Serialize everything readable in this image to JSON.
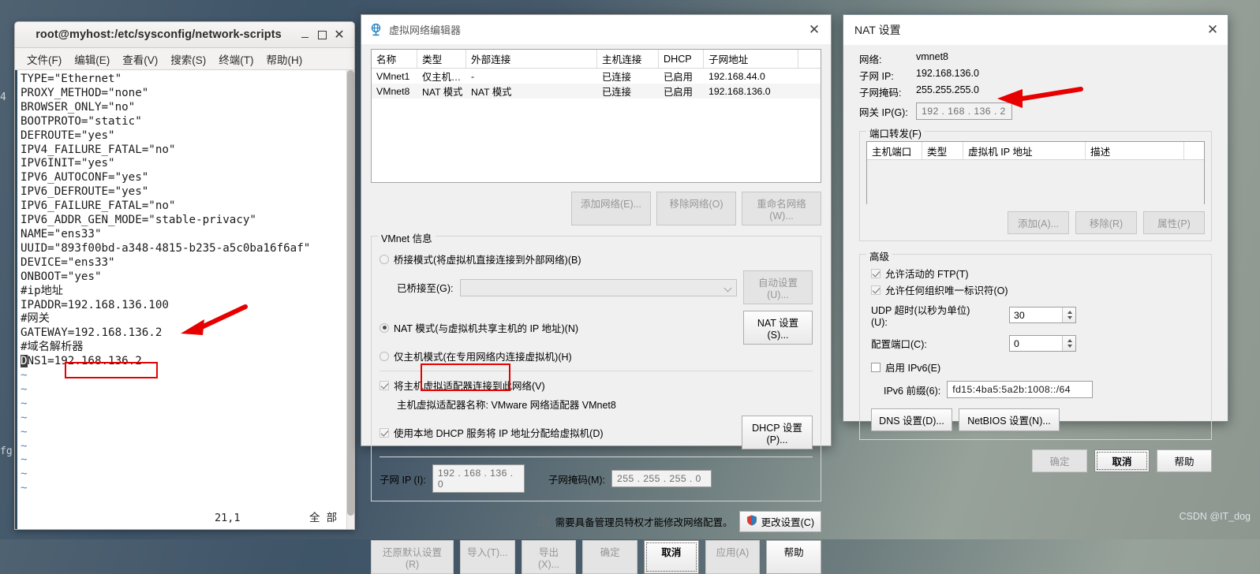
{
  "desktop": {
    "stray_text_left": "4",
    "stray_text_bottom": "fg",
    "watermark": "CSDN @IT_dog"
  },
  "terminal": {
    "title": "root@myhost:/etc/sysconfig/network-scripts",
    "buttons": {
      "minimize": "–",
      "maximize": "□",
      "close": "✕"
    },
    "menu": [
      "文件(F)",
      "编辑(E)",
      "查看(V)",
      "搜索(S)",
      "终端(T)",
      "帮助(H)"
    ],
    "lines": [
      "TYPE=\"Ethernet\"",
      "PROXY_METHOD=\"none\"",
      "BROWSER_ONLY=\"no\"",
      "BOOTPROTO=\"static\"",
      "DEFROUTE=\"yes\"",
      "IPV4_FAILURE_FATAL=\"no\"",
      "IPV6INIT=\"yes\"",
      "IPV6_AUTOCONF=\"yes\"",
      "IPV6_DEFROUTE=\"yes\"",
      "IPV6_FAILURE_FATAL=\"no\"",
      "IPV6_ADDR_GEN_MODE=\"stable-privacy\"",
      "NAME=\"ens33\"",
      "UUID=\"893f00bd-a348-4815-b235-a5c0ba16f6af\"",
      "DEVICE=\"ens33\"",
      "ONBOOT=\"yes\"",
      "#ip地址",
      "IPADDR=192.168.136.100",
      "#网关",
      "GATEWAY=192.168.136.2",
      "#域名解析器",
      "DNS1=192.168.136.2"
    ],
    "empty_marker": "~",
    "empty_count": 9,
    "status_position": "21,1",
    "status_all": "全 部"
  },
  "vmeditor": {
    "title": "虚拟网络编辑器",
    "close": "✕",
    "table": {
      "headers": [
        "名称",
        "类型",
        "外部连接",
        "主机连接",
        "DHCP",
        "子网地址"
      ],
      "rows": [
        {
          "name": "VMnet1",
          "type": "仅主机…",
          "external": "-",
          "host": "已连接",
          "dhcp": "已启用",
          "subnet": "192.168.44.0"
        },
        {
          "name": "VMnet8",
          "type": "NAT 模式",
          "external": "NAT 模式",
          "host": "已连接",
          "dhcp": "已启用",
          "subnet": "192.168.136.0"
        }
      ]
    },
    "table_buttons": [
      "添加网络(E)...",
      "移除网络(O)",
      "重命名网络(W)..."
    ],
    "info_legend": "VMnet 信息",
    "modes": {
      "bridged": "桥接模式(将虚拟机直接连接到外部网络)(B)",
      "bridged_to_label": "已桥接至(G):",
      "bridged_to_value": "",
      "auto_settings_button": "自动设置(U)...",
      "nat": "NAT 模式(与虚拟机共享主机的 IP 地址)(N)",
      "nat_settings_button": "NAT 设置(S)...",
      "hostonly": "仅主机模式(在专用网络内连接虚拟机)(H)"
    },
    "adapter": {
      "connect_host_adapter": "将主机虚拟适配器连接到此网络(V)",
      "adapter_name": "主机虚拟适配器名称: VMware 网络适配器 VMnet8",
      "use_local_dhcp": "使用本地 DHCP 服务将 IP 地址分配给虚拟机(D)",
      "dhcp_settings_button": "DHCP 设置(P)..."
    },
    "subnet": {
      "ip_label": "子网 IP (I):",
      "ip_value": "192 . 168 . 136 . 0",
      "mask_label": "子网掩码(M):",
      "mask_value": "255 . 255 . 255 . 0"
    },
    "notice": "需要具备管理员特权才能修改网络配置。",
    "change_settings_button": "更改设置(C)",
    "footer_buttons": [
      "还原默认设置(R)",
      "导入(T)...",
      "导出(X)...",
      "确定",
      "取消",
      "应用(A)",
      "帮助"
    ]
  },
  "natdialog": {
    "title": "NAT 设置",
    "close": "✕",
    "fields": {
      "network_label": "网络:",
      "network_value": "vmnet8",
      "subnet_ip_label": "子网 IP:",
      "subnet_ip_value": "192.168.136.0",
      "subnet_mask_label": "子网掩码:",
      "subnet_mask_value": "255.255.255.0",
      "gateway_label": "网关 IP(G):",
      "gateway_value": "192 . 168 . 136 . 2"
    },
    "portforward": {
      "legend": "端口转发(F)",
      "headers": [
        "主机端口",
        "类型",
        "虚拟机 IP 地址",
        "描述"
      ],
      "rows": [],
      "buttons": [
        "添加(A)...",
        "移除(R)",
        "属性(P)"
      ]
    },
    "advanced": {
      "legend": "高级",
      "allow_ftp": "允许活动的 FTP(T)",
      "allow_any_org": "允许任何组织唯一标识符(O)",
      "udp_timeout_label": "UDP 超时(以秒为单位)(U):",
      "udp_timeout_value": "30",
      "config_port_label": "配置端口(C):",
      "config_port_value": "0",
      "enable_ipv6": "启用 IPv6(E)",
      "ipv6_prefix_label": "IPv6 前缀(6):",
      "ipv6_prefix_value": "fd15:4ba5:5a2b:1008::/64",
      "dns_button": "DNS 设置(D)...",
      "netbios_button": "NetBIOS 设置(N)..."
    },
    "footer_buttons": [
      "确定",
      "取消",
      "帮助"
    ]
  }
}
